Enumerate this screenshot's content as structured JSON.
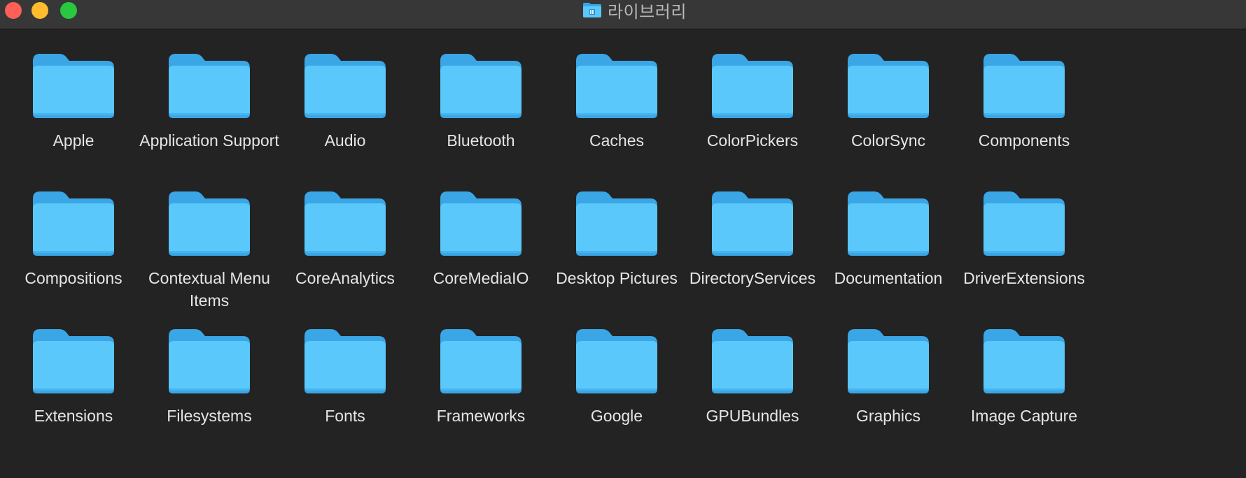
{
  "window": {
    "title": "라이브러리",
    "title_icon": "library-folder-icon"
  },
  "colors": {
    "background": "#232323",
    "titlebar": "#373737",
    "folder_light": "#5ac8fa",
    "folder_dark": "#3aa6e6",
    "label": "#e6e6e6",
    "close": "#fe5f57",
    "minimize": "#febc2e",
    "zoom": "#28c840"
  },
  "items": [
    {
      "name": "Apple",
      "icon": "folder-icon"
    },
    {
      "name": "Application Support",
      "icon": "folder-icon"
    },
    {
      "name": "Audio",
      "icon": "folder-icon"
    },
    {
      "name": "Bluetooth",
      "icon": "folder-icon"
    },
    {
      "name": "Caches",
      "icon": "folder-icon"
    },
    {
      "name": "ColorPickers",
      "icon": "folder-icon"
    },
    {
      "name": "ColorSync",
      "icon": "folder-icon"
    },
    {
      "name": "Components",
      "icon": "folder-icon"
    },
    {
      "name": "Compositions",
      "icon": "folder-icon"
    },
    {
      "name": "Contextual Menu Items",
      "icon": "folder-icon"
    },
    {
      "name": "CoreAnalytics",
      "icon": "folder-icon"
    },
    {
      "name": "CoreMediaIO",
      "icon": "folder-icon"
    },
    {
      "name": "Desktop Pictures",
      "icon": "folder-icon"
    },
    {
      "name": "DirectoryServices",
      "icon": "folder-icon"
    },
    {
      "name": "Documentation",
      "icon": "folder-icon"
    },
    {
      "name": "DriverExtensions",
      "icon": "folder-icon"
    },
    {
      "name": "Extensions",
      "icon": "folder-icon"
    },
    {
      "name": "Filesystems",
      "icon": "folder-icon"
    },
    {
      "name": "Fonts",
      "icon": "folder-icon"
    },
    {
      "name": "Frameworks",
      "icon": "folder-icon"
    },
    {
      "name": "Google",
      "icon": "folder-icon"
    },
    {
      "name": "GPUBundles",
      "icon": "folder-icon"
    },
    {
      "name": "Graphics",
      "icon": "folder-icon"
    },
    {
      "name": "Image Capture",
      "icon": "folder-icon"
    }
  ]
}
